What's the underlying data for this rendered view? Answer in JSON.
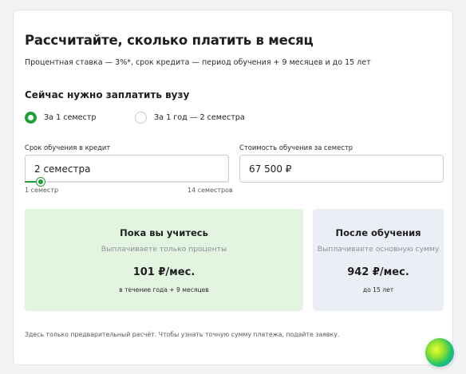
{
  "header": {
    "title": "Рассчитайте, сколько платить в месяц",
    "subtitle": "Процентная ставка — 3%*, срок кредита — период обучения + 9 месяцев и до 15 лет"
  },
  "payment": {
    "section_title": "Сейчас нужно заплатить вузу",
    "options": [
      {
        "label": "За 1 семестр",
        "selected": true
      },
      {
        "label": "За 1 год — 2 семестра",
        "selected": false
      }
    ]
  },
  "term": {
    "label": "Срок обучения в кредит",
    "value": "2 семестра",
    "slider_min_label": "1 семестр",
    "slider_max_label": "14 семестров",
    "slider_min": 1,
    "slider_max": 14,
    "slider_value": 2
  },
  "cost": {
    "label": "Стоимость обучения за семестр",
    "value": "67 500 ₽"
  },
  "results": {
    "during": {
      "title": "Пока вы учитесь",
      "description": "Выплачиваете только проценты",
      "amount": "101 ₽/мес.",
      "note": "в течение года + 9 месяцев"
    },
    "after": {
      "title": "После обучения",
      "description": "Выплачиваете основную сумму",
      "amount": "942 ₽/мес.",
      "note": "до 15 лет"
    }
  },
  "disclaimer": "Здесь только предварительный расчёт. Чтобы узнать точную сумму платежа, подайте заявку.",
  "colors": {
    "accent": "#21a038",
    "study_panel_bg": "#e3f5e1",
    "after_panel_bg": "#ebeff5"
  },
  "icons": {
    "assistant": "assistant-orb-icon"
  }
}
